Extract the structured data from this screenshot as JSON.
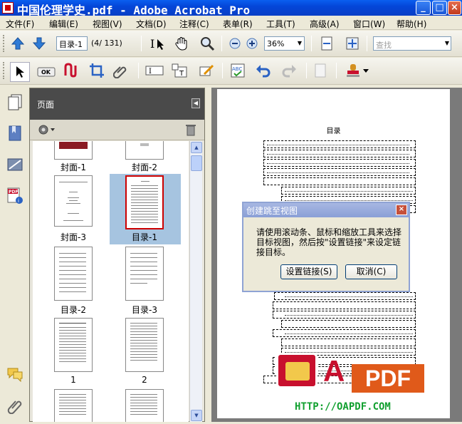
{
  "window": {
    "title": "中国伦理学史.pdf - Adobe Acrobat Pro",
    "minimize": "_",
    "maximize": "□",
    "close": "×"
  },
  "menu": {
    "items": [
      {
        "label": "文件(F)"
      },
      {
        "label": "编辑(E)"
      },
      {
        "label": "视图(V)"
      },
      {
        "label": "文档(D)"
      },
      {
        "label": "注释(C)"
      },
      {
        "label": "表单(R)"
      },
      {
        "label": "工具(T)"
      },
      {
        "label": "高级(A)"
      },
      {
        "label": "窗口(W)"
      },
      {
        "label": "帮助(H)"
      }
    ]
  },
  "toolbar": {
    "page_input": "目录-1",
    "page_count": "(4/ 131)",
    "zoom": "36%",
    "search_placeholder": "查找"
  },
  "pages_panel": {
    "title": "页面",
    "thumbnails": [
      {
        "label": "封面-1",
        "style": "cover"
      },
      {
        "label": "封面-2",
        "style": "cover"
      },
      {
        "label": "封面-3",
        "style": "title"
      },
      {
        "label": "目录-1",
        "style": "toc",
        "selected": true
      },
      {
        "label": "目录-2",
        "style": "toc"
      },
      {
        "label": "目录-3",
        "style": "toc"
      },
      {
        "label": "1",
        "style": "text"
      },
      {
        "label": "2",
        "style": "text"
      },
      {
        "label": "",
        "style": "text"
      },
      {
        "label": "",
        "style": "text"
      }
    ]
  },
  "document": {
    "page_title": "目录"
  },
  "dialog": {
    "title": "创建跳至视图",
    "message": "请使用滚动条、鼠标和缩放工具来选择目标视图，然后按\"设置链接\"来设定链接目标。",
    "set_link_button": "设置链接(S)",
    "cancel_button": "取消(C)"
  },
  "watermark": {
    "letter": "A",
    "brand": "PDF",
    "url": "HTTP://OAPDF.COM"
  },
  "colors": {
    "titlebar": "#0a4fe0",
    "selection": "#a6c4e0",
    "selected_border": "#cc0000",
    "watermark_red": "#c8102e",
    "watermark_orange": "#e05a1a",
    "watermark_green": "#12a030"
  }
}
